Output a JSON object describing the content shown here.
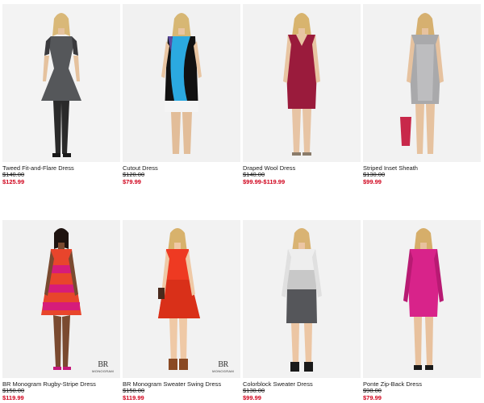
{
  "products": [
    {
      "name": "Tweed Fit-and-Flare Dress",
      "was_price": "$140.00",
      "sale_price": "$125.99",
      "colors": {
        "bg": "#f3f3f3",
        "dress": "#55575a",
        "accent": "#3a3a3d",
        "legs": "#2a2a2a"
      }
    },
    {
      "name": "Cutout Dress",
      "was_price": "$120.00",
      "sale_price": "$79.99",
      "colors": {
        "bg": "#f1f1f1",
        "dress": "#111111",
        "accent": "#2ba9e0",
        "legs": "#e2bd99"
      }
    },
    {
      "name": "Draped Wool Dress",
      "was_price": "$140.00",
      "sale_price": "$99.99-$119.99",
      "colors": {
        "bg": "#f2f2f2",
        "dress": "#9a1b3c",
        "accent": "#7e1531",
        "legs": "#e7c4a4"
      }
    },
    {
      "name": "Striped Inset Sheath",
      "was_price": "$130.00",
      "sale_price": "$99.99",
      "colors": {
        "bg": "#f2f2f2",
        "dress": "#a9a9ab",
        "accent": "#c8284a",
        "legs": "#e6c29f"
      }
    },
    {
      "name": "BR Monogram Rugby-Stripe Dress",
      "was_price": "$150.00",
      "sale_price": "$119.99",
      "brand_mark": {
        "mono": "BR",
        "text": "MONOGRAM"
      },
      "colors": {
        "bg": "#f1f1f1",
        "dress": "#e8452c",
        "accent": "#d61c7a",
        "legs": "#7a4a30"
      }
    },
    {
      "name": "BR Monogram Sweater Swing Dress",
      "was_price": "$150.00",
      "sale_price": "$119.99",
      "brand_mark": {
        "mono": "BR",
        "text": "MONOGRAM"
      },
      "colors": {
        "bg": "#f2f2f2",
        "dress": "#ee3a22",
        "accent": "#d93019",
        "legs": "#efc9a6"
      }
    },
    {
      "name": "Colorblock Sweater Dress",
      "was_price": "$130.00",
      "sale_price": "$99.99",
      "colors": {
        "bg": "#f2f2f2",
        "dress": "#55565a",
        "accent": "#c8c8c8",
        "legs": "#ecc6a4"
      }
    },
    {
      "name": "Ponte Zip-Back Dress",
      "was_price": "$98.00",
      "sale_price": "$79.99",
      "colors": {
        "bg": "#f2f2f2",
        "dress": "#d8238a",
        "accent": "#b81a73",
        "legs": "#e8c19d"
      }
    }
  ]
}
